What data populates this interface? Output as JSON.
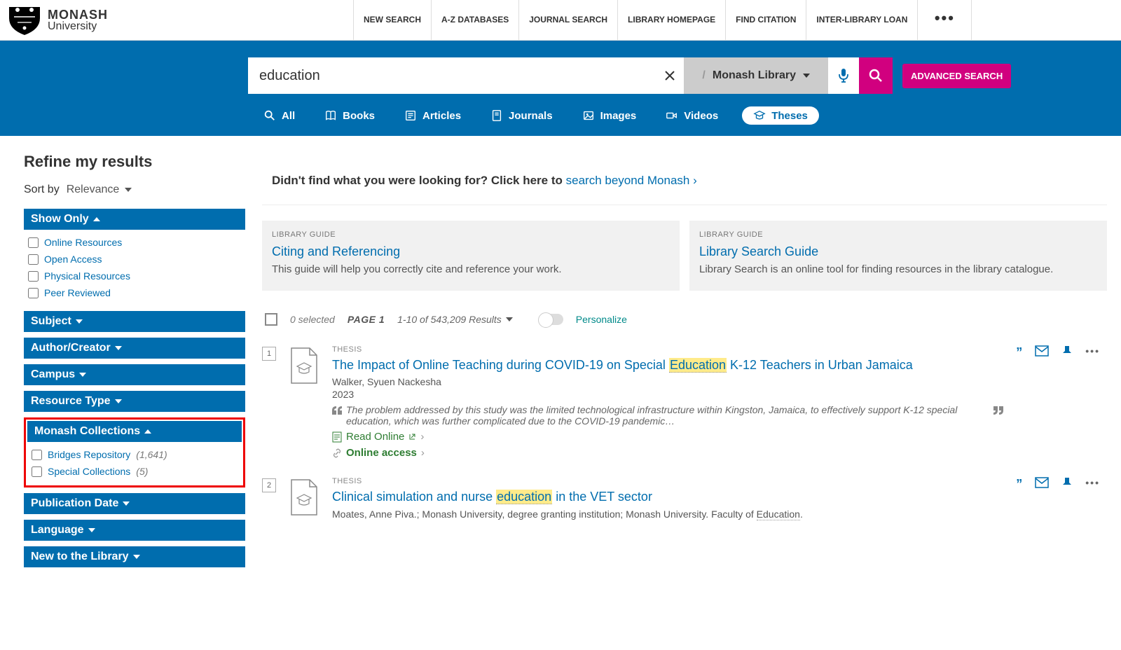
{
  "header": {
    "logo": {
      "name": "MONASH",
      "sub": "University"
    },
    "nav": [
      "NEW SEARCH",
      "A-Z DATABASES",
      "JOURNAL SEARCH",
      "LIBRARY HOMEPAGE",
      "FIND CITATION",
      "INTER-LIBRARY LOAN"
    ]
  },
  "search": {
    "query": "education",
    "scope": "Monash Library",
    "advanced": "ADVANCED SEARCH",
    "tabs": [
      "All",
      "Books",
      "Articles",
      "Journals",
      "Images",
      "Videos",
      "Theses"
    ],
    "active_tab": "Theses"
  },
  "sidebar": {
    "refine_title": "Refine my results",
    "sort_label": "Sort by",
    "sort_value": "Relevance",
    "facets": {
      "show_only": {
        "title": "Show Only",
        "expanded": true,
        "items": [
          {
            "label": "Online Resources"
          },
          {
            "label": "Open Access"
          },
          {
            "label": "Physical Resources"
          },
          {
            "label": "Peer Reviewed"
          }
        ]
      },
      "subject": {
        "title": "Subject",
        "expanded": false
      },
      "author": {
        "title": "Author/Creator",
        "expanded": false
      },
      "campus": {
        "title": "Campus",
        "expanded": false
      },
      "resource_type": {
        "title": "Resource Type",
        "expanded": false
      },
      "monash_collections": {
        "title": "Monash Collections",
        "expanded": true,
        "highlighted": true,
        "items": [
          {
            "label": "Bridges Repository",
            "count": "(1,641)"
          },
          {
            "label": "Special Collections",
            "count": "(5)"
          }
        ]
      },
      "pub_date": {
        "title": "Publication Date",
        "expanded": false
      },
      "language": {
        "title": "Language",
        "expanded": false
      },
      "new_library": {
        "title": "New to the Library",
        "expanded": false
      }
    }
  },
  "content": {
    "notfound_prefix": "Didn't find what you were looking for? Click here to ",
    "notfound_link": "search beyond Monash",
    "guides": [
      {
        "label": "LIBRARY GUIDE",
        "title": "Citing and Referencing",
        "desc": "This guide will help you correctly cite and reference your work."
      },
      {
        "label": "LIBRARY GUIDE",
        "title": "Library Search Guide",
        "desc": "Library Search is an online tool for finding resources in the library catalogue."
      }
    ],
    "results_header": {
      "selected": "0 selected",
      "page_label": "PAGE 1",
      "range": "1-10 of 543,209 Results",
      "personalize": "Personalize"
    },
    "results": [
      {
        "num": "1",
        "type": "THESIS",
        "title_pre": "The Impact of Online Teaching during COVID-19 on Special ",
        "title_hl": "Education",
        "title_post": " K-12 Teachers in Urban Jamaica",
        "author": "Walker, Syuen Nackesha",
        "year": "2023",
        "abstract": "The problem addressed by this study was the limited technological infrastructure within Kingston, Jamaica, to effectively support K-12 special education, which was further complicated due to the COVID-19 pandemic…",
        "read_online": "Read Online",
        "online_access": "Online access"
      },
      {
        "num": "2",
        "type": "THESIS",
        "title_pre": "Clinical simulation and nurse ",
        "title_hl": "education",
        "title_post": " in the VET sector",
        "author_line_pre": "Moates, Anne Piva.; Monash University, degree granting institution; Monash University. Faculty of ",
        "author_line_hl": "Education",
        "author_line_post": "."
      }
    ]
  }
}
